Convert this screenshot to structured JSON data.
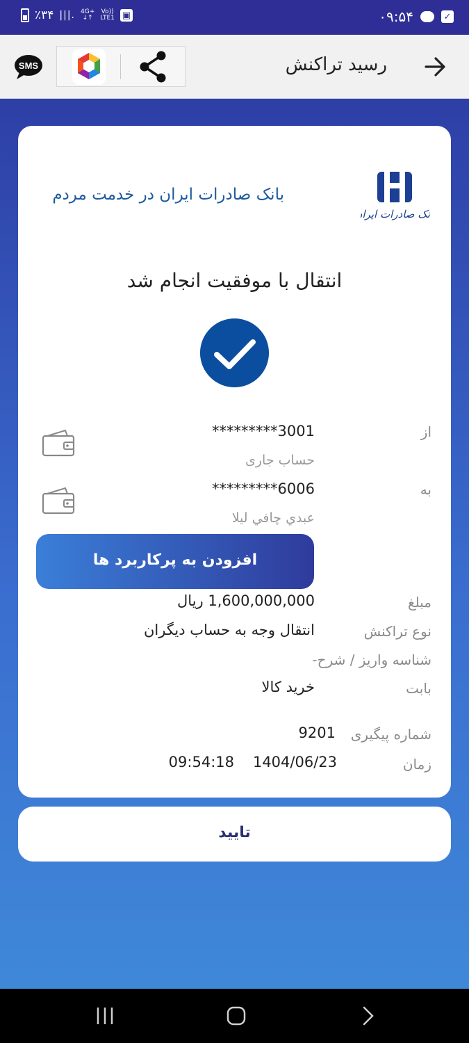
{
  "status_bar": {
    "time": "۰۹:۵۴",
    "battery": "٪۳۴",
    "network": "4G+",
    "volte": "Vo))",
    "lte": "LTE1"
  },
  "header": {
    "title": "رسید تراکنش",
    "sms_label": "SMS"
  },
  "bank": {
    "slogan": "بانک صادرات ایران در خدمت مردم",
    "logo_text": "بانک صادرات ایران"
  },
  "receipt": {
    "success_message": "انتقال با موفقیت انجام شد",
    "from": {
      "label": "از",
      "account": "*********3001",
      "account_type": "حساب جاری"
    },
    "to": {
      "label": "به",
      "account": "*********6006",
      "owner": "عبدي چافي ليلا"
    },
    "add_button": "افزودن به پرکاربرد ها",
    "amount": {
      "label": "مبلغ",
      "value": "1,600,000,000 ریال"
    },
    "transaction_type": {
      "label": "نوع تراکنش",
      "value": "انتقال وجه به حساب دیگران"
    },
    "deposit_id": {
      "label": "شناسه واریز / شرح",
      "value": "-"
    },
    "purpose": {
      "label": "بابت",
      "value": "خرید کالا"
    },
    "tracking": {
      "label": "شماره پیگیری",
      "value": "9201"
    },
    "time": {
      "label": "زمان",
      "date": "1404/06/23",
      "clock": "09:54:18"
    }
  },
  "confirm_button": "تایید",
  "colors": {
    "primary": "#2e3fa6",
    "accent": "#0b4ea0",
    "slogan": "#1e5a9f"
  }
}
